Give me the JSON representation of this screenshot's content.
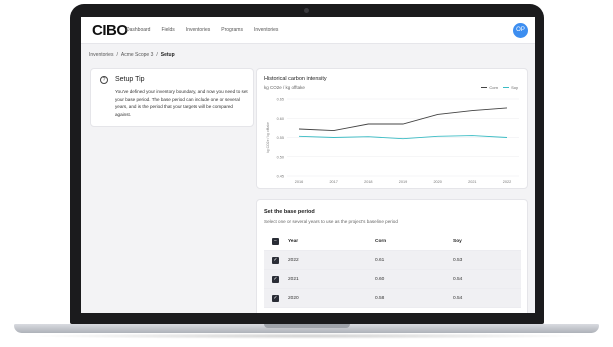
{
  "nav": {
    "logo": "CIBO",
    "links": [
      "Dashboard",
      "Fields",
      "Inventories",
      "Programs",
      "Inventories"
    ],
    "avatar_initials": "OP"
  },
  "breadcrumb": {
    "items": [
      "Inventories",
      "/",
      "Acme Scope 3",
      "/",
      "Setup"
    ]
  },
  "tip": {
    "icon": "question-circle-icon",
    "title": "Setup Tip",
    "body": "You've defined your inventory boundary, and now you need to set your base period. The base period can include one or several years, and is the period that your targets will be compared against."
  },
  "chart_data": {
    "type": "line",
    "title": "Historical carbon intensity",
    "subtitle": "kg CO2e / kg offtake",
    "ylabel": "kg CO2e / kg offtake",
    "x": [
      2016,
      2017,
      2018,
      2019,
      2020,
      2021,
      2022
    ],
    "ylim": [
      0.45,
      0.65
    ],
    "yticks": [
      0.45,
      0.5,
      0.55,
      0.6,
      0.65
    ],
    "ytick_labels": [
      "0.45",
      "0.50",
      "0.55",
      "0.60",
      "0.65"
    ],
    "grid": true,
    "legend": "top-right",
    "series": [
      {
        "name": "Corn",
        "color": "#444444",
        "values": [
          0.572,
          0.568,
          0.585,
          0.585,
          0.61,
          0.62,
          0.627
        ]
      },
      {
        "name": "Soy",
        "color": "#3bbcc4",
        "values": [
          0.553,
          0.55,
          0.552,
          0.547,
          0.553,
          0.555,
          0.55
        ]
      }
    ]
  },
  "period": {
    "title": "Set the base period",
    "subtitle": "Select one or several years to use as the project's baseline period",
    "headers": {
      "year": "Year",
      "corn": "Corn",
      "soy": "Soy"
    },
    "rows": [
      {
        "year": "2022",
        "corn": "0.61",
        "soy": "0.53",
        "checked": true
      },
      {
        "year": "2021",
        "corn": "0.60",
        "soy": "0.54",
        "checked": true
      },
      {
        "year": "2020",
        "corn": "0.58",
        "soy": "0.54",
        "checked": true
      }
    ]
  },
  "colors": {
    "accent": "#3d8ef0",
    "corn": "#444444",
    "soy": "#3bbcc4",
    "checkbox": "#2a2d36"
  }
}
